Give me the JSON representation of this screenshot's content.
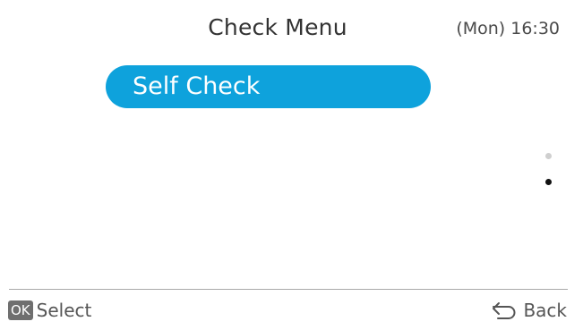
{
  "header": {
    "title": "Check Menu",
    "clock": "(Mon) 16:30"
  },
  "menu": {
    "items": [
      {
        "label": "Self Check",
        "selected": true
      }
    ]
  },
  "pagination": {
    "total_pages": 2,
    "current_page": 2
  },
  "footer": {
    "ok_badge": "OK",
    "select_label": "Select",
    "back_label": "Back",
    "back_icon": "back-arrow-icon"
  },
  "colors": {
    "accent": "#0ea2dc",
    "active_dot": "#111111",
    "inactive_dot": "#cfcfcf",
    "badge": "#6f6f6f"
  }
}
